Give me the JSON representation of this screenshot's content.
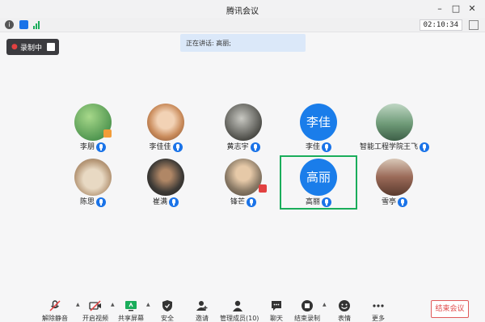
{
  "window": {
    "title": "腾讯会议"
  },
  "info": {
    "timer": "02:10:34"
  },
  "record": {
    "label": "录制中"
  },
  "speaking": {
    "text": "正在讲话: 高丽;"
  },
  "participants": [
    {
      "name": "李朋",
      "avatar": "photo",
      "avatar_color": "#3c8c3c"
    },
    {
      "name": "李佳佳",
      "avatar": "photo",
      "avatar_color": "#d9a37a"
    },
    {
      "name": "黄志宇",
      "avatar": "photo",
      "avatar_color": "#5a5a55"
    },
    {
      "name": "李佳",
      "avatar": "text",
      "avatar_text": "李佳"
    },
    {
      "name": "智能工程学院王飞",
      "avatar": "photo",
      "avatar_color": "#6e9a77"
    },
    {
      "name": "陈思",
      "avatar": "photo",
      "avatar_color": "#b89a7a"
    },
    {
      "name": "崔满",
      "avatar": "photo",
      "avatar_color": "#3d3a36"
    },
    {
      "name": "锋芒",
      "avatar": "photo",
      "avatar_color": "#8a7a66"
    },
    {
      "name": "高丽",
      "avatar": "text",
      "avatar_text": "高丽",
      "speaking": true
    },
    {
      "name": "雪亭",
      "avatar": "photo",
      "avatar_color": "#9a6a58"
    }
  ],
  "toolbar": {
    "unmute": "解除静音",
    "video": "开启视频",
    "share": "共享屏幕",
    "security": "安全",
    "invite": "邀请",
    "members": "管理成员(10)",
    "chat": "聊天",
    "end_record": "结束录制",
    "emoji": "表情",
    "more": "更多",
    "end_meeting": "结束会议"
  },
  "colors": {
    "accent": "#1a73e8",
    "speaking_frame": "#1aad5b",
    "end_red": "#e04848"
  }
}
